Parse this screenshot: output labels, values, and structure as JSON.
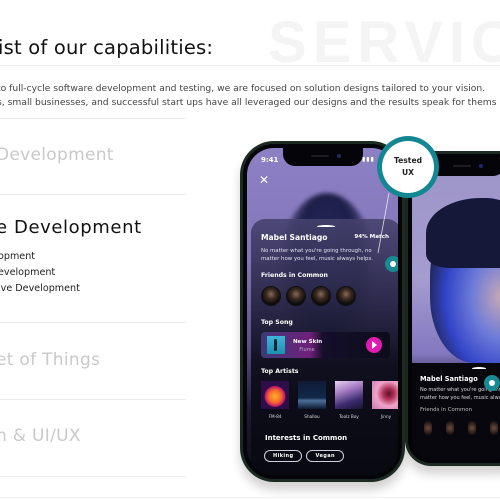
{
  "watermark": "SERVIC",
  "heading": "ist of our capabilities:",
  "intro": {
    "line1": "to full-cycle software development and testing, we are focused on solution designs tailored to your vision.",
    "line2": "s, small businesses, and successful start ups have all leveraged our designs and the results speak for thems"
  },
  "capabilities": [
    {
      "title": "Development",
      "active": false
    },
    {
      "title": "e Development",
      "active": true,
      "items": [
        "opment",
        "evelopment",
        "ive Development"
      ]
    },
    {
      "title": "et of Things",
      "active": false
    },
    {
      "title": "n & UI/UX",
      "active": false
    }
  ],
  "badge": {
    "line1": "Tested",
    "line2": "UX"
  },
  "phone_main": {
    "time": "9:41",
    "status_icons": "▮▮▮ ◔",
    "close_icon": "✕",
    "profile": {
      "name": "Mabel Santiago",
      "match": "94% Match",
      "quote": "No matter what you're going through, no matter how you feel, music always helps."
    },
    "friends_title": "Friends in Common",
    "top_song_title": "Top Song",
    "song": {
      "title": "New Skin",
      "artist": "Flume"
    },
    "top_artists_title": "Top Artists",
    "artists": [
      "FM-84",
      "Shallou",
      "Toolz Boy",
      "Jinny"
    ],
    "interests_title": "Interests in Common",
    "interests": [
      "Hiking",
      "Vegan"
    ]
  },
  "phone_second": {
    "name": "Mabel Santiago",
    "quote_line1": "No matter what you're going through,",
    "quote_line2": "matter how you feel, music always help",
    "friends_title": "Friends in Common"
  },
  "colors": {
    "accent": "#148892",
    "play": "#e01ab3"
  }
}
